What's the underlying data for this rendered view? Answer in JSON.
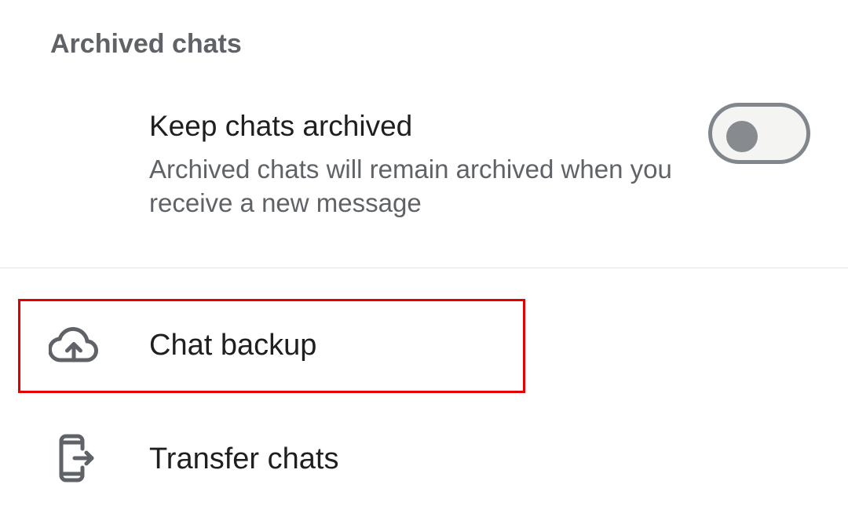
{
  "section": {
    "header": "Archived chats"
  },
  "keep_archived": {
    "title": "Keep chats archived",
    "description": "Archived chats will remain archived when you receive a new message",
    "toggle_on": false
  },
  "menu": {
    "chat_backup": {
      "label": "Chat backup",
      "icon": "cloud-upload-icon"
    },
    "transfer_chats": {
      "label": "Transfer chats",
      "icon": "phone-transfer-icon"
    }
  },
  "colors": {
    "highlight": "#e30000",
    "secondary_text": "#5f6368",
    "primary_text": "#1f1f1f"
  }
}
